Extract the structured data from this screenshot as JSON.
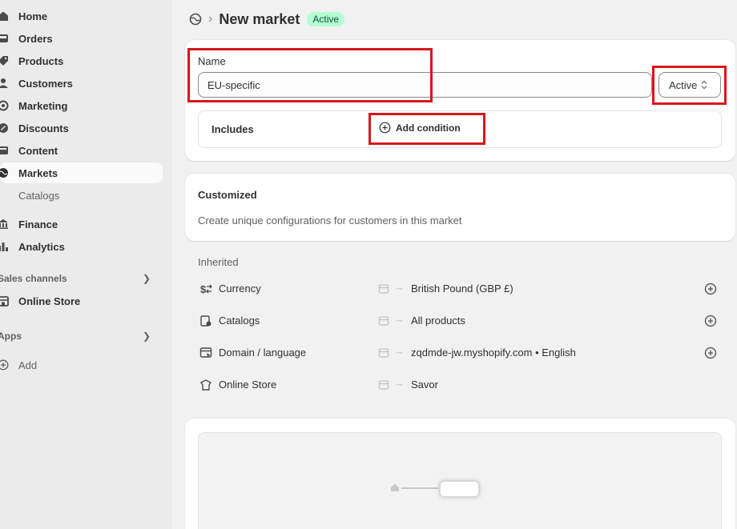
{
  "sidebar": {
    "items": [
      {
        "label": "Home",
        "icon": "home-icon"
      },
      {
        "label": "Orders",
        "icon": "inbox-icon"
      },
      {
        "label": "Products",
        "icon": "tag-icon"
      },
      {
        "label": "Customers",
        "icon": "person-icon"
      },
      {
        "label": "Marketing",
        "icon": "target-icon"
      },
      {
        "label": "Discounts",
        "icon": "discount-icon"
      },
      {
        "label": "Content",
        "icon": "content-icon"
      },
      {
        "label": "Markets",
        "icon": "globe-icon"
      }
    ],
    "sub_item": "Catalogs",
    "items2": [
      {
        "label": "Finance",
        "icon": "bank-icon"
      },
      {
        "label": "Analytics",
        "icon": "bar-chart-icon"
      }
    ],
    "sales_channels_label": "Sales channels",
    "online_store_label": "Online Store",
    "apps_label": "Apps",
    "add_label": "Add"
  },
  "header": {
    "title": "New market",
    "badge": "Active"
  },
  "form": {
    "name_label": "Name",
    "name_value": "EU-specific",
    "status_value": "Active",
    "includes_label": "Includes",
    "add_condition_label": "Add condition"
  },
  "customized": {
    "title": "Customized",
    "description": "Create unique configurations for customers in this market"
  },
  "inherited": {
    "title": "Inherited",
    "rows": [
      {
        "label": "Currency",
        "value": "British Pound (GBP £)",
        "icon": "currency-icon",
        "has_add": true
      },
      {
        "label": "Catalogs",
        "value": "All products",
        "icon": "catalog-icon",
        "has_add": true
      },
      {
        "label": "Domain / language",
        "value": "zqdmde-jw.myshopify.com • English",
        "icon": "domain-icon",
        "has_add": true
      },
      {
        "label": "Online Store",
        "value": "Savor",
        "icon": "theme-icon",
        "has_add": false
      }
    ]
  },
  "colors": {
    "accent_badge_bg": "#b4fed2",
    "annotation_red": "#d6191c"
  }
}
